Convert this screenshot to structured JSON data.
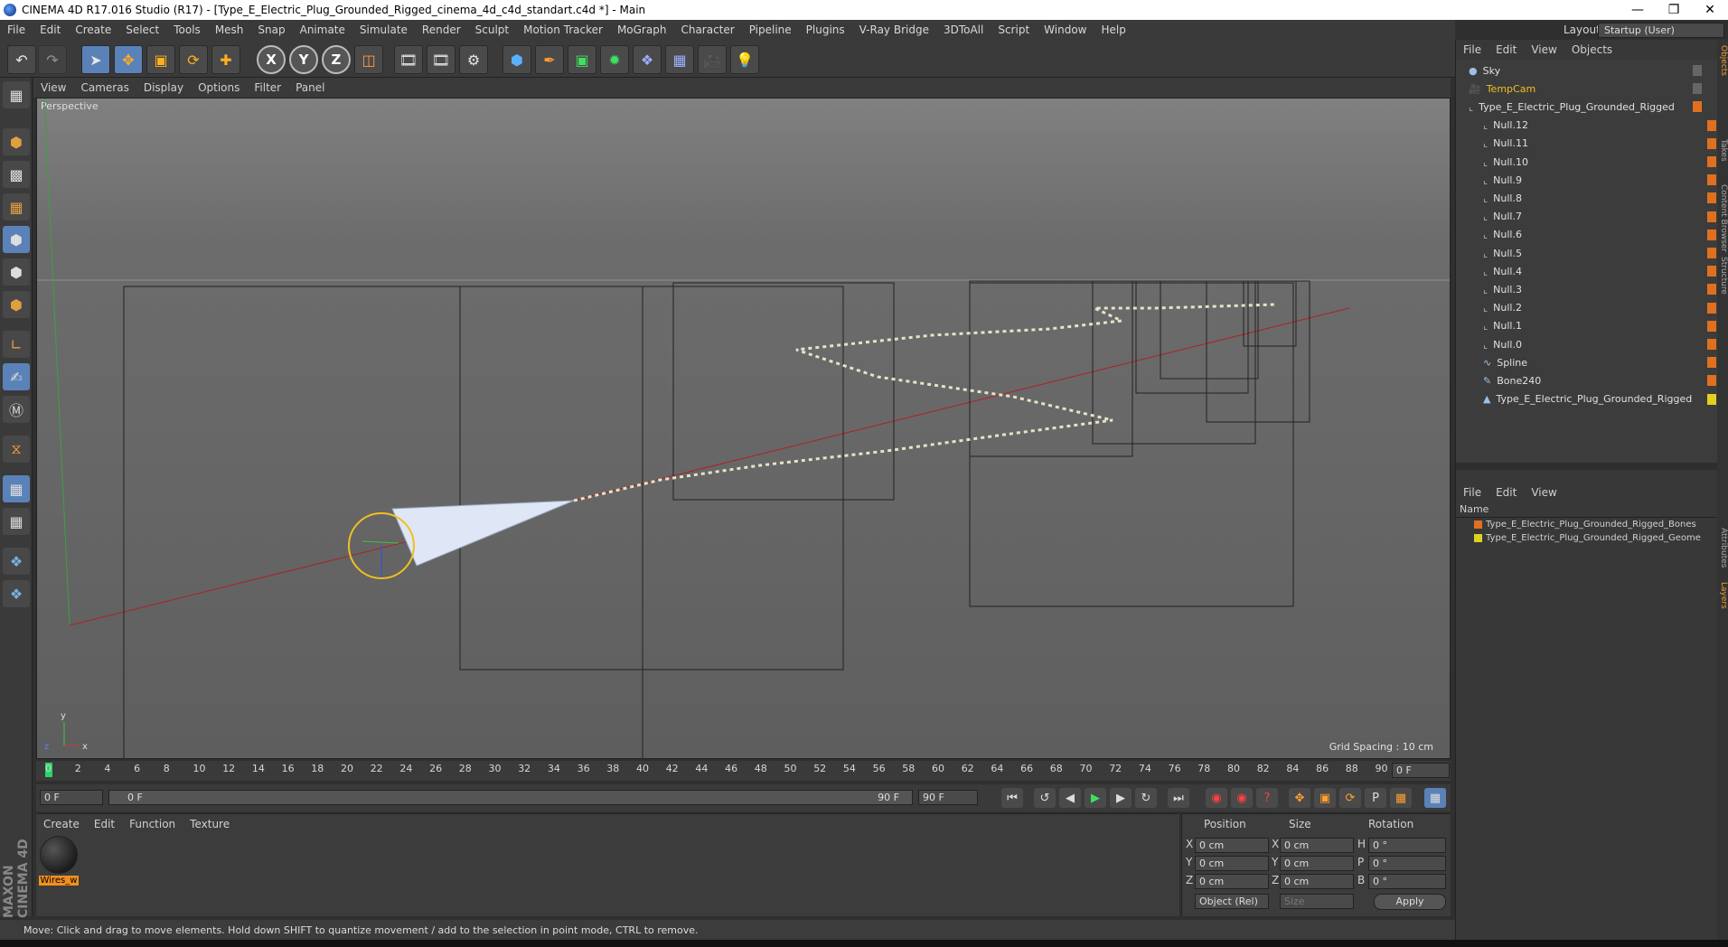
{
  "window": {
    "title": "CINEMA 4D R17.016 Studio (R17) - [Type_E_Electric_Plug_Grounded_Rigged_cinema_4d_c4d_standart.c4d *] - Main"
  },
  "menubar": [
    "File",
    "Edit",
    "Create",
    "Select",
    "Tools",
    "Mesh",
    "Snap",
    "Animate",
    "Simulate",
    "Render",
    "Sculpt",
    "Motion Tracker",
    "MoGraph",
    "Character",
    "Pipeline",
    "Plugins",
    "V-Ray Bridge",
    "3DToAll",
    "Script",
    "Window",
    "Help"
  ],
  "layout": {
    "label": "Layout:",
    "value": "Startup (User)"
  },
  "toolbar": {
    "icons": [
      "undo-icon",
      "redo-icon",
      "select-arrow-icon",
      "move-icon",
      "scale-icon",
      "rotate-icon",
      "last-tool-icon",
      "x-axis-icon",
      "y-axis-icon",
      "z-axis-icon",
      "world-coord-icon",
      "render-view-icon",
      "render-picture-icon",
      "render-settings-icon",
      "cube-icon",
      "pen-icon",
      "subdivision-icon",
      "array-icon",
      "deformer-icon",
      "floor-icon",
      "camera-icon",
      "light-icon"
    ],
    "axis_labels": [
      "X",
      "Y",
      "Z"
    ]
  },
  "viewport": {
    "menu": [
      "View",
      "Cameras",
      "Display",
      "Options",
      "Filter",
      "Panel"
    ],
    "label": "Perspective",
    "grid_spacing": "Grid Spacing : 10 cm"
  },
  "timeline": {
    "ticks": [
      "0",
      "2",
      "4",
      "6",
      "8",
      "10",
      "12",
      "14",
      "16",
      "18",
      "20",
      "22",
      "24",
      "26",
      "28",
      "30",
      "32",
      "34",
      "36",
      "38",
      "40",
      "42",
      "44",
      "46",
      "48",
      "50",
      "52",
      "54",
      "56",
      "58",
      "60",
      "62",
      "64",
      "66",
      "68",
      "70",
      "72",
      "74",
      "76",
      "78",
      "80",
      "82",
      "84",
      "86",
      "88",
      "90"
    ],
    "current_frame": "0 F"
  },
  "playbar": {
    "start": "0 F",
    "slider_left": "0 F",
    "slider_right": "90 F",
    "end": "90 F"
  },
  "materials": {
    "menu": [
      "Create",
      "Edit",
      "Function",
      "Texture"
    ],
    "items": [
      {
        "name": "Wires_w"
      }
    ]
  },
  "coordinates": {
    "headers": {
      "position": "Position",
      "size": "Size",
      "rotation": "Rotation"
    },
    "rows": [
      {
        "axis": "X",
        "pos": "0 cm",
        "size_axis": "X",
        "size": "0 cm",
        "rot_axis": "H",
        "rot": "0 °"
      },
      {
        "axis": "Y",
        "pos": "0 cm",
        "size_axis": "Y",
        "size": "0 cm",
        "rot_axis": "P",
        "rot": "0 °"
      },
      {
        "axis": "Z",
        "pos": "0 cm",
        "size_axis": "Z",
        "size": "0 cm",
        "rot_axis": "B",
        "rot": "0 °"
      }
    ],
    "mode": "Object (Rel)",
    "size_mode": "Size",
    "apply": "Apply"
  },
  "status": "Move: Click and drag to move elements. Hold down SHIFT to quantize movement / add to the selection in point mode, CTRL to remove.",
  "object_manager": {
    "menu": [
      "File",
      "Edit",
      "View",
      "Objects"
    ],
    "items": [
      {
        "name": "Sky",
        "indent": 0,
        "icon": "sky-icon",
        "color": "#e0e0e0"
      },
      {
        "name": "TempCam",
        "indent": 0,
        "icon": "camera-icon",
        "color": "#f0c020"
      },
      {
        "name": "Type_E_Electric_Plug_Grounded_Rigged",
        "indent": 0,
        "icon": "null-icon",
        "color": "#e0e0e0"
      },
      {
        "name": "Null.12",
        "indent": 1,
        "icon": "null-icon",
        "color": "#e0e0e0"
      },
      {
        "name": "Null.11",
        "indent": 1,
        "icon": "null-icon",
        "color": "#e0e0e0"
      },
      {
        "name": "Null.10",
        "indent": 1,
        "icon": "null-icon",
        "color": "#e0e0e0"
      },
      {
        "name": "Null.9",
        "indent": 1,
        "icon": "null-icon",
        "color": "#e0e0e0"
      },
      {
        "name": "Null.8",
        "indent": 1,
        "icon": "null-icon",
        "color": "#e0e0e0"
      },
      {
        "name": "Null.7",
        "indent": 1,
        "icon": "null-icon",
        "color": "#e0e0e0"
      },
      {
        "name": "Null.6",
        "indent": 1,
        "icon": "null-icon",
        "color": "#e0e0e0"
      },
      {
        "name": "Null.5",
        "indent": 1,
        "icon": "null-icon",
        "color": "#e0e0e0"
      },
      {
        "name": "Null.4",
        "indent": 1,
        "icon": "null-icon",
        "color": "#e0e0e0"
      },
      {
        "name": "Null.3",
        "indent": 1,
        "icon": "null-icon",
        "color": "#e0e0e0"
      },
      {
        "name": "Null.2",
        "indent": 1,
        "icon": "null-icon",
        "color": "#e0e0e0"
      },
      {
        "name": "Null.1",
        "indent": 1,
        "icon": "null-icon",
        "color": "#e0e0e0"
      },
      {
        "name": "Null.0",
        "indent": 1,
        "icon": "null-icon",
        "color": "#e0e0e0"
      },
      {
        "name": "Spline",
        "indent": 1,
        "icon": "spline-icon",
        "color": "#e0e0e0"
      },
      {
        "name": "Bone240",
        "indent": 1,
        "icon": "bone-icon",
        "color": "#e0e0e0"
      },
      {
        "name": "Type_E_Electric_Plug_Grounded_Rigged",
        "indent": 1,
        "icon": "mesh-icon",
        "color": "#e0e0e0"
      }
    ]
  },
  "layer_manager": {
    "menu": [
      "File",
      "Edit",
      "View"
    ],
    "header": "Name",
    "items": [
      {
        "name": "Type_E_Electric_Plug_Grounded_Rigged_Bones",
        "color": "#e07020"
      },
      {
        "name": "Type_E_Electric_Plug_Grounded_Rigged_Geome",
        "color": "#e0d020"
      }
    ]
  },
  "side_tabs": [
    "Objects",
    "Takes",
    "Content Browser",
    "Structure",
    "Attributes",
    "Layers"
  ],
  "brand": "MAXON CINEMA 4D"
}
